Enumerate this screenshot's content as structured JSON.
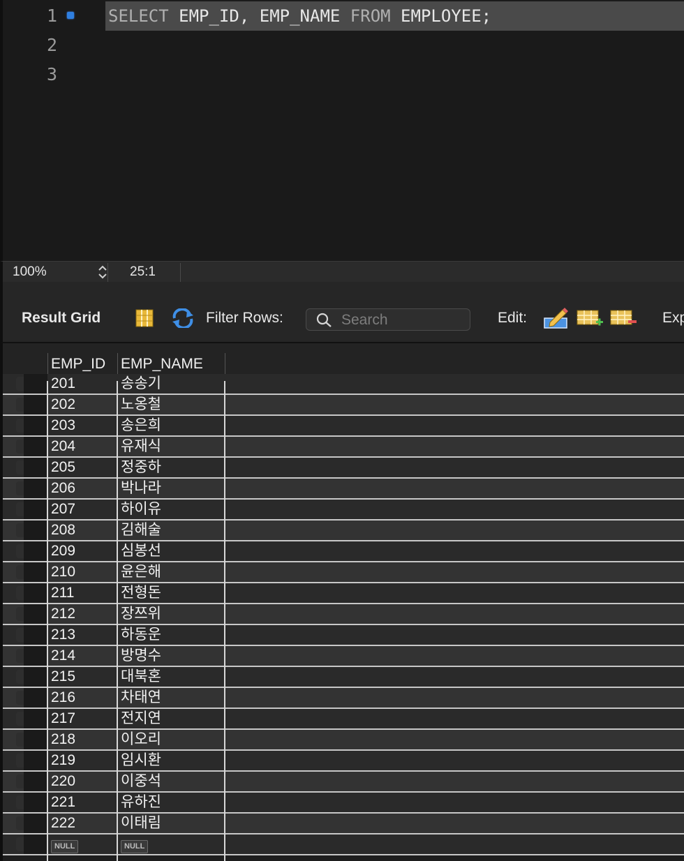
{
  "editor": {
    "line_numbers": [
      "1",
      "2",
      "3"
    ],
    "query_tokens": [
      {
        "text": "SELECT",
        "kind": "keyword"
      },
      {
        "text": " EMP_ID, EMP_NAME ",
        "kind": "plain"
      },
      {
        "text": "FROM",
        "kind": "keyword"
      },
      {
        "text": " EMPLOYEE;",
        "kind": "plain"
      }
    ]
  },
  "status": {
    "zoom": "100%",
    "cursor_position": "25:1"
  },
  "toolbar": {
    "result_grid_label": "Result Grid",
    "filter_rows_label": "Filter Rows:",
    "search_placeholder": "Search",
    "edit_label": "Edit:",
    "export_label_partial": "Exp"
  },
  "grid": {
    "columns": [
      "EMP_ID",
      "EMP_NAME"
    ],
    "rows": [
      [
        "201",
        "송송기"
      ],
      [
        "202",
        "노옹철"
      ],
      [
        "203",
        "송은희"
      ],
      [
        "204",
        "유재식"
      ],
      [
        "205",
        "정중하"
      ],
      [
        "206",
        "박나라"
      ],
      [
        "207",
        "하이유"
      ],
      [
        "208",
        "김해술"
      ],
      [
        "209",
        "심봉선"
      ],
      [
        "210",
        "윤은해"
      ],
      [
        "211",
        "전형돈"
      ],
      [
        "212",
        "장쯔위"
      ],
      [
        "213",
        "하동운"
      ],
      [
        "214",
        "방명수"
      ],
      [
        "215",
        "대북혼"
      ],
      [
        "216",
        "차태연"
      ],
      [
        "217",
        "전지연"
      ],
      [
        "218",
        "이오리"
      ],
      [
        "219",
        "임시환"
      ],
      [
        "220",
        "이중석"
      ],
      [
        "221",
        "유하진"
      ],
      [
        "222",
        "이태림"
      ]
    ],
    "null_row": [
      "NULL",
      "NULL"
    ]
  },
  "colors": {
    "exec_indicator": "#2f7fe0",
    "editor_bg": "#1a1a1a",
    "highlight_line": "#4a4a4a"
  }
}
